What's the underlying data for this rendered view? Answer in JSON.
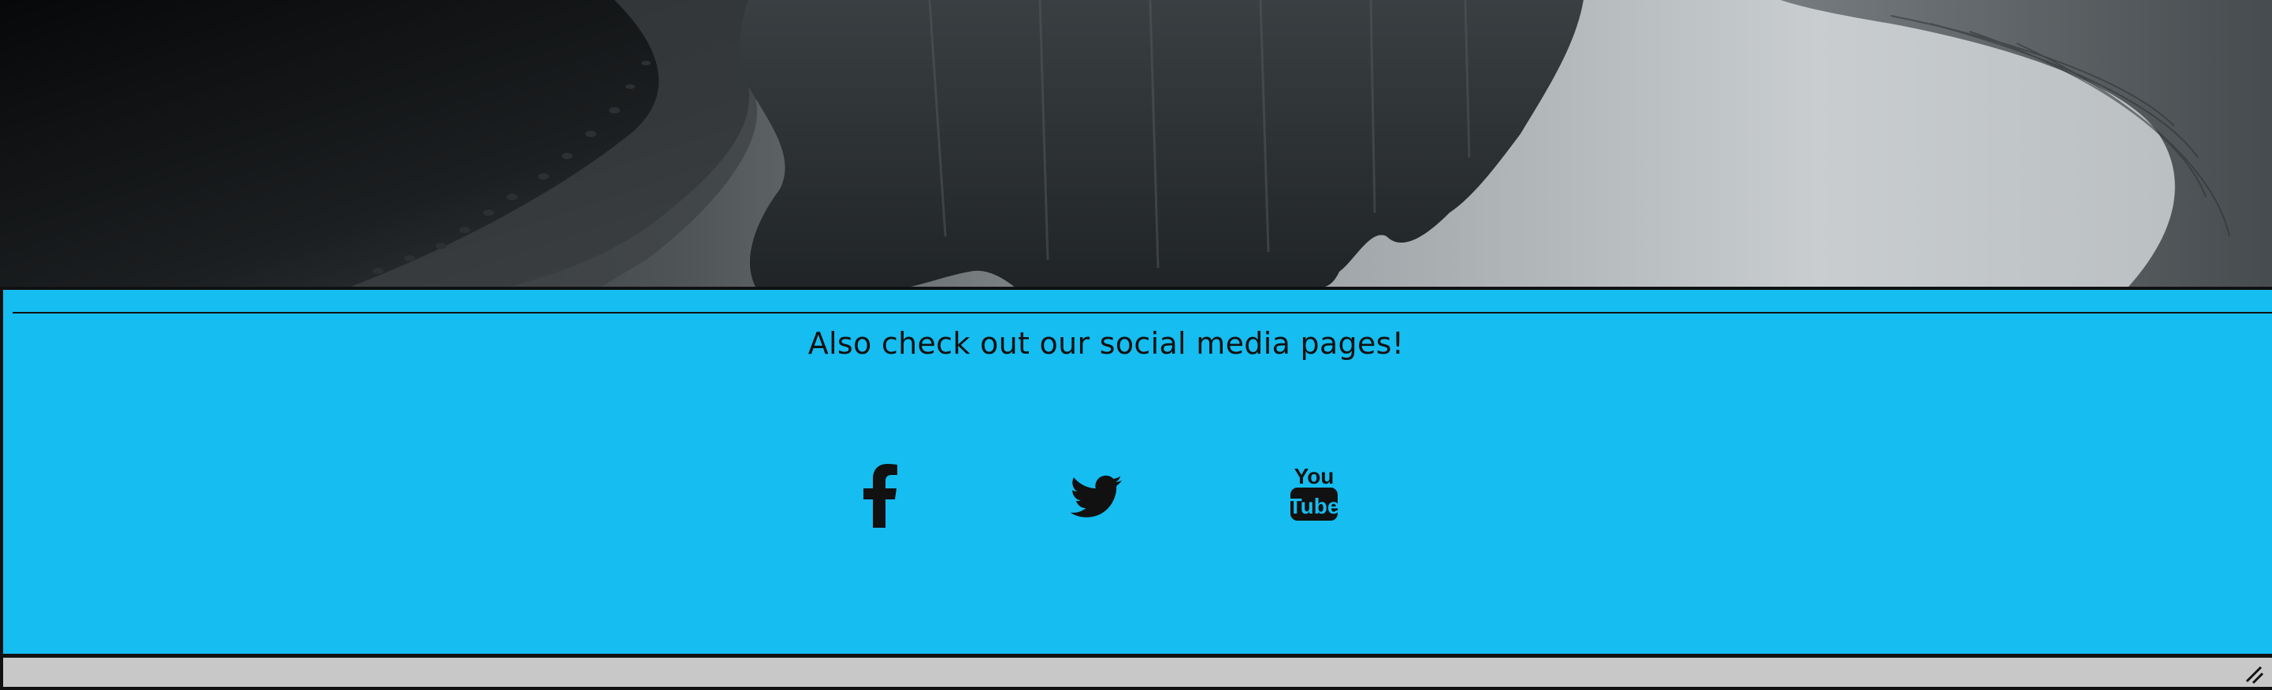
{
  "hero": {
    "image_description_icon": "mountain-reflection-photo"
  },
  "social": {
    "heading": "Also check out our social media pages!",
    "links": [
      {
        "name": "facebook",
        "icon": "facebook-icon"
      },
      {
        "name": "twitter",
        "icon": "twitter-icon"
      },
      {
        "name": "youtube",
        "icon": "youtube-icon",
        "logo_text_top": "You",
        "logo_text_bottom": "Tube"
      }
    ]
  },
  "colors": {
    "panel_background": "#16bdf0",
    "icon_color": "#111111",
    "bottom_bar": "#c8c8c8"
  }
}
